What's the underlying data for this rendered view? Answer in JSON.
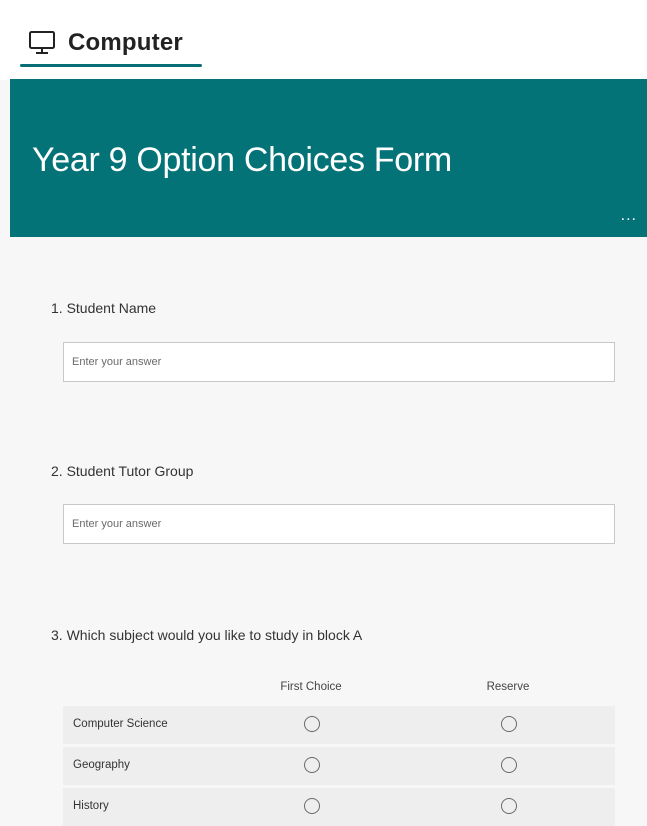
{
  "tab": {
    "label": "Computer",
    "icon": "monitor-icon",
    "accent": "#086f76"
  },
  "banner": {
    "title": "Year 9 Option Choices Form",
    "more": "...",
    "color": "#047378"
  },
  "questions": [
    {
      "label": "1. Student Name",
      "placeholder": "Enter your answer"
    },
    {
      "label": "2. Student Tutor Group",
      "placeholder": "Enter your answer"
    },
    {
      "label": "3. Which subject would you like to study in block A"
    }
  ],
  "matrix": {
    "columns": [
      "First Choice",
      "Reserve"
    ],
    "rows": [
      "Computer Science",
      "Geography",
      "History"
    ]
  }
}
